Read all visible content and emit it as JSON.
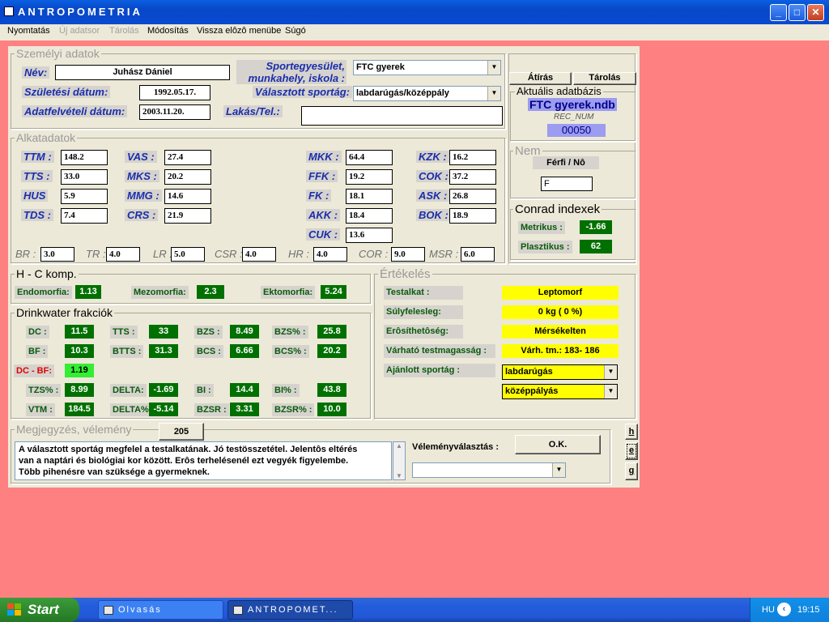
{
  "window": {
    "title": "ANTROPOMETRIA",
    "minimize": "_",
    "maximize": "□",
    "close": "✕"
  },
  "menu": [
    {
      "label": "Nyomtatás",
      "enabled": true
    },
    {
      "label": "Új adatsor",
      "enabled": false
    },
    {
      "label": "Tárolás",
      "enabled": false
    },
    {
      "label": "Módosítás",
      "enabled": true
    },
    {
      "label": "Vissza elôzô menübe",
      "enabled": true
    },
    {
      "label": "Súgó",
      "enabled": true
    }
  ],
  "personal": {
    "group_title": "Személyi adatok",
    "name_label": "Név:",
    "name_value": "Juhász Dániel",
    "birth_label": "Születési dátum:",
    "birth_value": "1992.05.17.",
    "record_date_label": "Adatfelvételi dátum:",
    "record_date_value": "2003.11.20.",
    "club_label_1": "Sportegyesület,",
    "club_label_2": "munkahely, iskola :",
    "club_value": "FTC gyerek",
    "sport_label": "Választott sportág:",
    "sport_value": "labdarúgás/középpály",
    "address_label": "Lakás/Tel.:",
    "address_value": ""
  },
  "actions": {
    "atiras": "Átírás",
    "tarolas": "Tárolás"
  },
  "database": {
    "title": "Aktuális adatbázis",
    "file": "FTC gyerek.ndb",
    "rec_label": "REC_NUM",
    "rec_value": "00050"
  },
  "gender": {
    "title": "Nem",
    "label": "Férfi / Nô",
    "value": "F"
  },
  "conrad": {
    "title": "Conrad indexek",
    "metric_label": "Metrikus :",
    "metric_value": "-1.66",
    "plastic_label": "Plasztikus :",
    "plastic_value": "62"
  },
  "body": {
    "group_title": "Alkatadatok",
    "col1": [
      {
        "label": "TTM :",
        "value": "148.2"
      },
      {
        "label": "TTS :",
        "value": "33.0"
      },
      {
        "label": "HUS",
        "value": "5.9"
      },
      {
        "label": "TDS :",
        "value": "7.4"
      }
    ],
    "col2": [
      {
        "label": "VAS :",
        "value": "27.4"
      },
      {
        "label": "MKS :",
        "value": "20.2"
      },
      {
        "label": "MMG :",
        "value": "14.6"
      },
      {
        "label": "CRS :",
        "value": "21.9"
      }
    ],
    "col3": [
      {
        "label": "MKK :",
        "value": "64.4"
      },
      {
        "label": "FFK :",
        "value": "19.2"
      },
      {
        "label": "FK :",
        "value": "18.1"
      },
      {
        "label": "AKK :",
        "value": "18.4"
      },
      {
        "label": "CUK :",
        "value": "13.6"
      }
    ],
    "col4": [
      {
        "label": "KZK :",
        "value": "16.2"
      },
      {
        "label": "COK :",
        "value": "37.2"
      },
      {
        "label": "ASK :",
        "value": "26.8"
      },
      {
        "label": "BOK :",
        "value": "18.9"
      }
    ],
    "ratios": [
      {
        "label": "BR :",
        "value": "3.0"
      },
      {
        "label": "TR :",
        "value": "4.0"
      },
      {
        "label": "LR :",
        "value": "5.0"
      },
      {
        "label": "CSR :",
        "value": "4.0"
      },
      {
        "label": "HR :",
        "value": "4.0"
      },
      {
        "label": "COR :",
        "value": "9.0"
      },
      {
        "label": "MSR :",
        "value": "6.0"
      }
    ]
  },
  "hc": {
    "title": "H - C komp.",
    "items": [
      {
        "label": "Endomorfia:",
        "value": "1.13"
      },
      {
        "label": "Mezomorfia:",
        "value": "2.3"
      },
      {
        "label": "Ektomorfia:",
        "value": "5.24"
      }
    ]
  },
  "drinkwater": {
    "title": "Drinkwater frakciók",
    "rows": [
      [
        {
          "label": "DC :",
          "value": "11.5"
        },
        {
          "label": "TTS :",
          "value": "33"
        },
        {
          "label": "BZS :",
          "value": "8.49"
        },
        {
          "label": "BZS% :",
          "value": "25.8"
        }
      ],
      [
        {
          "label": "BF :",
          "value": "10.3"
        },
        {
          "label": "BTTS :",
          "value": "31.3"
        },
        {
          "label": "BCS :",
          "value": "6.66"
        },
        {
          "label": "BCS% :",
          "value": "20.2"
        }
      ],
      [
        {
          "label": "DC - BF:",
          "value": "1.19"
        }
      ],
      [
        {
          "label": "TZS% :",
          "value": "8.99"
        },
        {
          "label": "DELTA:",
          "value": "-1.69"
        },
        {
          "label": "BI :",
          "value": "14.4"
        },
        {
          "label": "BI% :",
          "value": "43.8"
        }
      ],
      [
        {
          "label": "VTM :",
          "value": "184.5"
        },
        {
          "label": "DELTA%:",
          "value": "-5.14"
        },
        {
          "label": "BZSR :",
          "value": "3.31"
        },
        {
          "label": "BZSR% :",
          "value": "10.0"
        }
      ]
    ]
  },
  "evaluation": {
    "title": "Értékelés",
    "items": [
      {
        "label": "Testalkat :",
        "value": "Leptomorf"
      },
      {
        "label": "Súlyfelesleg:",
        "value": "0 kg  ( 0 %)"
      },
      {
        "label": "Erôsíthetôség:",
        "value": "Mérsékelten"
      },
      {
        "label": "Várható testmagasság :",
        "value": "Várh. tm.: 183- 186"
      }
    ],
    "recommended_label": "Ajánlott sportág :",
    "recommended_1": "labdarúgás",
    "recommended_2": "középpályás"
  },
  "comment": {
    "title": "Megjegyzés, vélemény",
    "count": "205",
    "text_1": "A választott sportág megfelel a testalkatának. Jó testösszetétel. Jelentôs eltérés",
    "text_2": "van a naptári és biológiai kor között. Erôs terhelésenél ezt vegyék figyelembe.",
    "text_3": "Több pihenésre van szüksége a gyermeknek.",
    "choice_label": "Véleményválasztás :",
    "ok": "O.K.",
    "choice_value": "",
    "side_buttons": [
      "h",
      "e",
      "g"
    ]
  },
  "taskbar": {
    "start": "Start",
    "tasks": [
      "Olvasás",
      "ANTROPOMET..."
    ],
    "lang": "HU",
    "clock": "19:15"
  }
}
